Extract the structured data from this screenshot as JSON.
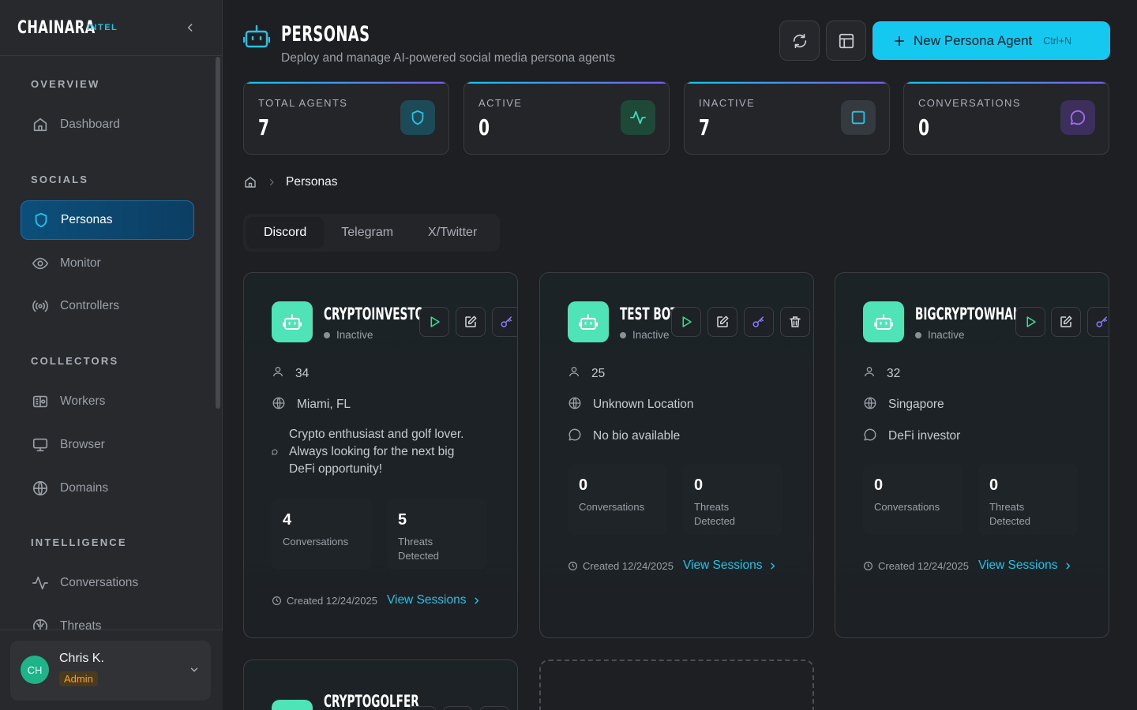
{
  "app": {
    "brand": "CHAINARA",
    "brand_sub": "INTEL"
  },
  "sidebar": {
    "sections": [
      {
        "title": "OVERVIEW"
      },
      {
        "title": "SOCIALS"
      },
      {
        "title": "COLLECTORS"
      },
      {
        "title": "INTELLIGENCE"
      }
    ],
    "items": [
      {
        "label": "Dashboard",
        "icon": "home-icon"
      },
      {
        "label": "Personas",
        "icon": "shield-icon",
        "active": true
      },
      {
        "label": "Monitor",
        "icon": "eye-icon"
      },
      {
        "label": "Controllers",
        "icon": "broadcast-icon"
      },
      {
        "label": "Workers",
        "icon": "workers-icon"
      },
      {
        "label": "Browser",
        "icon": "monitor-icon"
      },
      {
        "label": "Domains",
        "icon": "globe-icon"
      },
      {
        "label": "Conversations",
        "icon": "activity-icon"
      },
      {
        "label": "Threats",
        "icon": "brain-icon"
      }
    ]
  },
  "user": {
    "initials": "CH",
    "name": "Chris K.",
    "role": "Admin"
  },
  "header": {
    "title": "PERSONAS",
    "subtitle": "Deploy and manage AI-powered social media persona agents",
    "new_button": "New Persona Agent",
    "shortcut": "Ctrl+N"
  },
  "stats": [
    {
      "label": "TOTAL AGENTS",
      "value": "7",
      "icon": "shield-icon",
      "color": "#22c3e6"
    },
    {
      "label": "ACTIVE",
      "value": "0",
      "icon": "activity-icon",
      "color": "#3ddc97"
    },
    {
      "label": "INACTIVE",
      "value": "7",
      "icon": "square-icon",
      "color": "#22c3e6"
    },
    {
      "label": "CONVERSATIONS",
      "value": "0",
      "icon": "message-icon",
      "color": "#a06cf0"
    }
  ],
  "breadcrumb": {
    "current": "Personas"
  },
  "tabs": [
    {
      "label": "Discord",
      "active": true
    },
    {
      "label": "Telegram"
    },
    {
      "label": "X/Twitter"
    }
  ],
  "personas": [
    {
      "name": "CRYPTOINVESTOR",
      "status": "Inactive",
      "age": "34",
      "location": "Miami, FL",
      "bio_lines": [
        "Crypto enthusiast and golf lover.",
        "Always looking for the next big",
        "DeFi opportunity!"
      ],
      "conversations": "4",
      "conversations_label": "Conversations",
      "threats": "5",
      "threats_label": "Threats Detected",
      "created": "Created 12/24/2025",
      "link": "View Sessions"
    },
    {
      "name": "TEST BOT",
      "status": "Inactive",
      "age": "25",
      "location": "Unknown Location",
      "bio": "No bio available",
      "conversations": "0",
      "conversations_label": "Conversations",
      "threats": "0",
      "threats_label": "Threats Detected",
      "created": "Created 12/24/2025",
      "link": "View Sessions"
    },
    {
      "name": "BIGCRYPTOWHALE",
      "status": "Inactive",
      "age": "32",
      "location": "Singapore",
      "bio": "DeFi investor",
      "conversations": "0",
      "conversations_label": "Conversations",
      "threats": "0",
      "threats_label": "Threats Detected",
      "created": "Created 12/24/2025",
      "link": "View Sessions"
    },
    {
      "name": "CRYPTOGOLFER"
    }
  ],
  "colors": {
    "accent": "#14c8ef",
    "active_nav": "#0b4f7a",
    "avatar_green": "#4fe3b8",
    "play_green": "#3ddc97",
    "key_purple": "#8b7cf6"
  }
}
